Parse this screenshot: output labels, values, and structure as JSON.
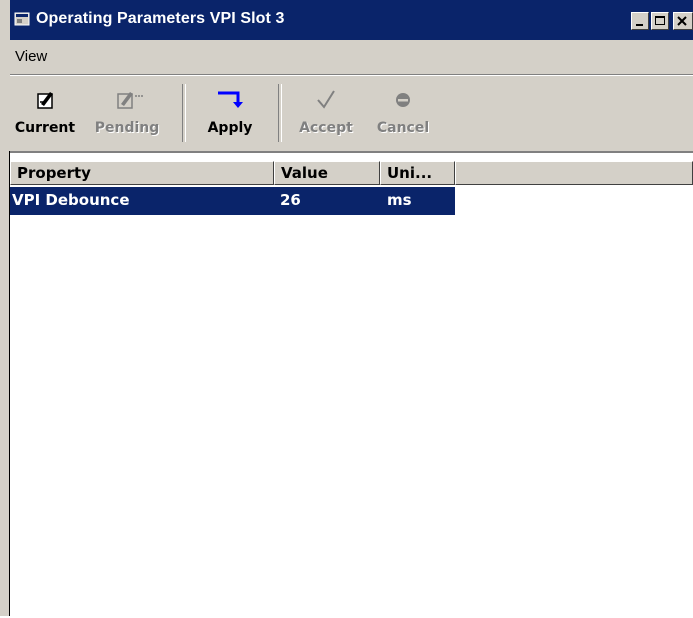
{
  "window": {
    "title": "Operating Parameters VPI Slot 3"
  },
  "menu": {
    "items": [
      {
        "label": "View"
      }
    ]
  },
  "toolbar": {
    "current": "Current",
    "pending": "Pending",
    "apply": "Apply",
    "accept": "Accept",
    "cancel": "Cancel"
  },
  "table": {
    "columns": [
      "Property",
      "Value",
      "Uni..."
    ],
    "rows": [
      {
        "property": "VPI Debounce",
        "value": "26",
        "unit": "ms",
        "selected": true
      }
    ]
  },
  "colors": {
    "title_bar": "#0a246a",
    "selection": "#0a246a",
    "face": "#d4d0c8"
  }
}
